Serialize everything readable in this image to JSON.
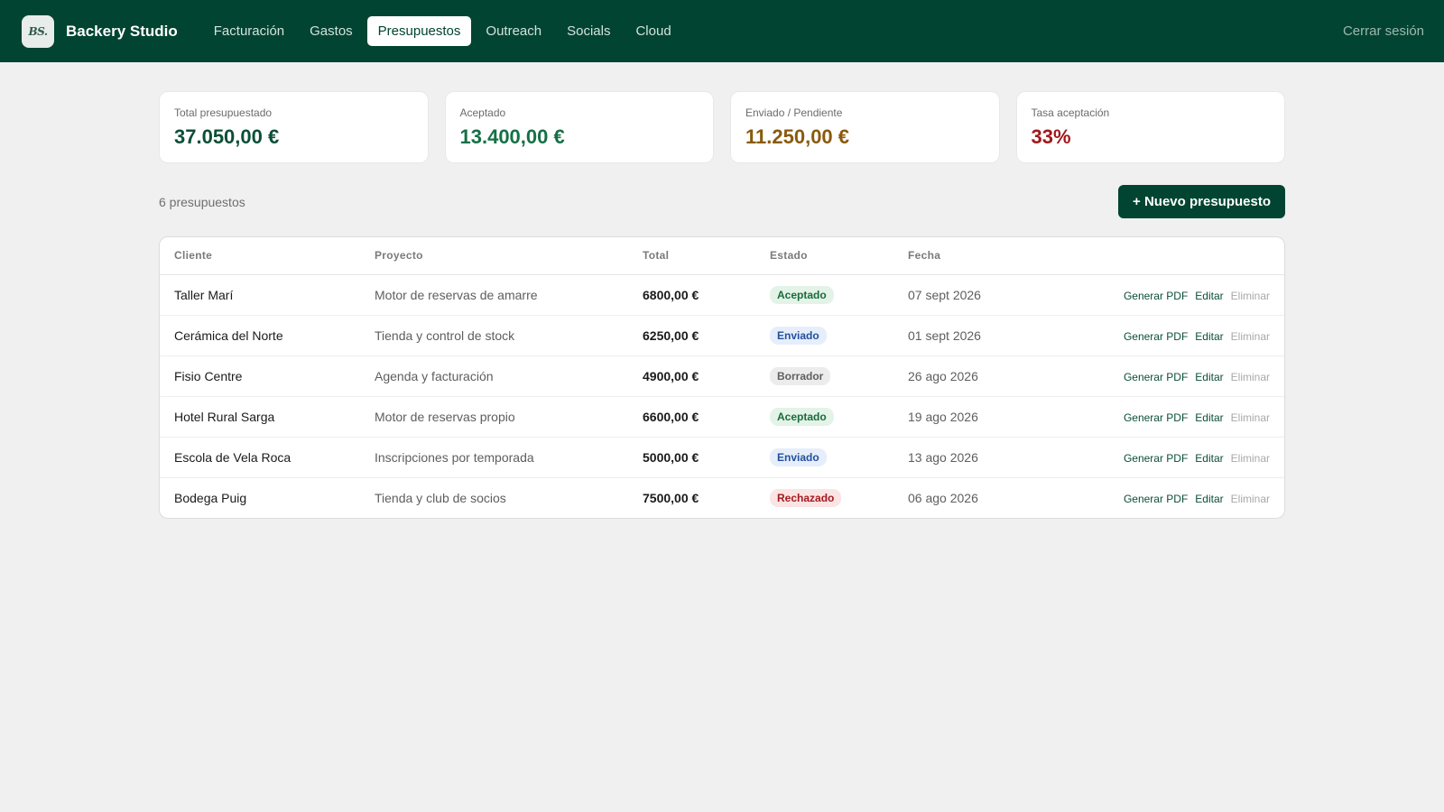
{
  "app": {
    "logo_text": "BS.",
    "brand": "Backery Studio",
    "nav": [
      {
        "label": "Facturación",
        "active": false
      },
      {
        "label": "Gastos",
        "active": false
      },
      {
        "label": "Presupuestos",
        "active": true
      },
      {
        "label": "Outreach",
        "active": false
      },
      {
        "label": "Socials",
        "active": false
      },
      {
        "label": "Cloud",
        "active": false
      }
    ],
    "logout": "Cerrar sesión",
    "colors": {
      "header": "#004431",
      "accent": "#004431",
      "background": "#f0f0f0"
    }
  },
  "kpis": [
    {
      "label": "Total presupuestado",
      "value": "37.050,00 €"
    },
    {
      "label": "Aceptado",
      "value": "13.400,00 €"
    },
    {
      "label": "Enviado / Pendiente",
      "value": "11.250,00 €"
    },
    {
      "label": "Tasa aceptación",
      "value": "33%"
    }
  ],
  "toolbar": {
    "count": "6 presupuestos",
    "new_button": "+ Nuevo presupuesto"
  },
  "table": {
    "columns": [
      "Cliente",
      "Proyecto",
      "Total",
      "Estado",
      "Fecha"
    ],
    "actions": {
      "pdf": "Generar PDF",
      "edit": "Editar",
      "delete": "Eliminar"
    },
    "rows": [
      {
        "cliente": "Taller Marí",
        "proyecto": "Motor de reservas de amarre",
        "total": "6800,00 €",
        "estado": "Aceptado",
        "fecha": "07 sept 2026"
      },
      {
        "cliente": "Cerámica del Norte",
        "proyecto": "Tienda y control de stock",
        "total": "6250,00 €",
        "estado": "Enviado",
        "fecha": "01 sept 2026"
      },
      {
        "cliente": "Fisio Centre",
        "proyecto": "Agenda y facturación",
        "total": "4900,00 €",
        "estado": "Borrador",
        "fecha": "26 ago 2026"
      },
      {
        "cliente": "Hotel Rural Sarga",
        "proyecto": "Motor de reservas propio",
        "total": "6600,00 €",
        "estado": "Aceptado",
        "fecha": "19 ago 2026"
      },
      {
        "cliente": "Escola de Vela Roca",
        "proyecto": "Inscripciones por temporada",
        "total": "5000,00 €",
        "estado": "Enviado",
        "fecha": "13 ago 2026"
      },
      {
        "cliente": "Bodega Puig",
        "proyecto": "Tienda y club de socios",
        "total": "7500,00 €",
        "estado": "Rechazado",
        "fecha": "06 ago 2026"
      }
    ]
  }
}
